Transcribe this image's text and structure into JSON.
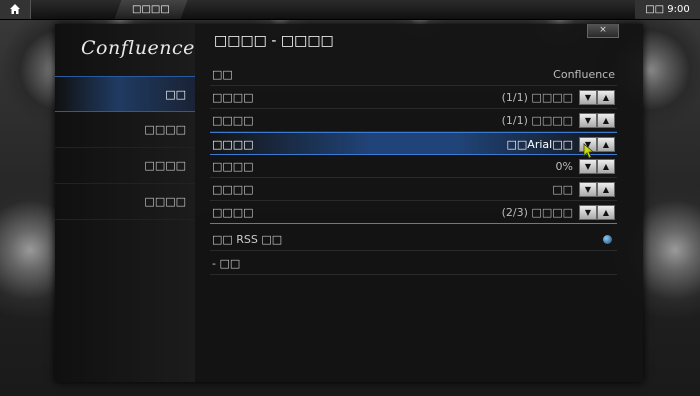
{
  "topbar": {
    "breadcrumb": "□□□□",
    "clock": "□□ 9:00"
  },
  "dialog": {
    "title": "□□□□ - □□□□",
    "close_label": "×",
    "logo": "Confluence"
  },
  "sidebar": {
    "items": [
      {
        "label": "□□"
      },
      {
        "label": "□□□□"
      },
      {
        "label": "□□□□"
      },
      {
        "label": "□□□□"
      }
    ]
  },
  "settings": {
    "rows": [
      {
        "label": "□□",
        "value": "Confluence"
      },
      {
        "label": "□□□□",
        "value": "(1/1) □□□□"
      },
      {
        "label": "□□□□",
        "value": "(1/1) □□□□"
      },
      {
        "label": "□□□□",
        "value": "□□Arial□□"
      },
      {
        "label": "□□□□",
        "value": "0%"
      },
      {
        "label": "□□□□",
        "value": "□□"
      },
      {
        "label": "□□□□",
        "value": "(2/3) □□□□"
      },
      {
        "label": "□□ RSS □□",
        "value": ""
      },
      {
        "label": "- □□",
        "value": ""
      }
    ]
  },
  "icons": {
    "home": "home-icon",
    "spin_down": "▼",
    "spin_up": "▲"
  },
  "colors": {
    "accent": "#2a64be",
    "radio": "#3a7ad0"
  }
}
